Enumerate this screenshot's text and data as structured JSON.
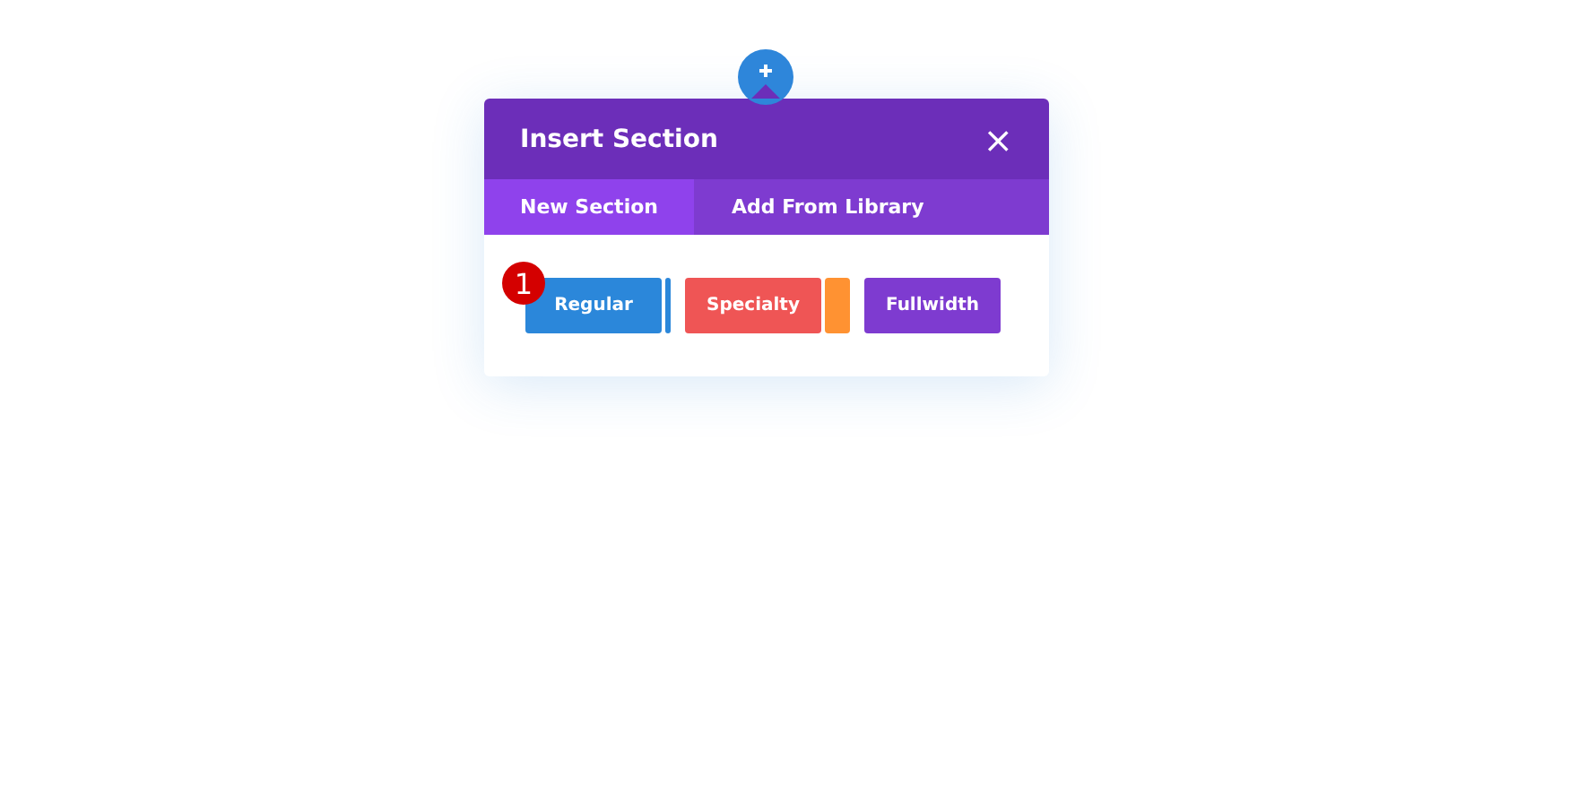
{
  "modal": {
    "title": "Insert Section",
    "close": "×",
    "tabs": [
      {
        "label": "New Section",
        "selected": true
      },
      {
        "label": "Add From Library",
        "selected": false
      }
    ],
    "buttons": [
      {
        "label": "Regular",
        "color": "#2b87da",
        "strip": {
          "color": "#2b87da"
        }
      },
      {
        "label": "Specialty",
        "color": "#ef5555",
        "strip": {
          "color": "#ff9232"
        }
      },
      {
        "label": "Fullwidth",
        "color": "#7e3bd0"
      }
    ],
    "badge": "1"
  }
}
